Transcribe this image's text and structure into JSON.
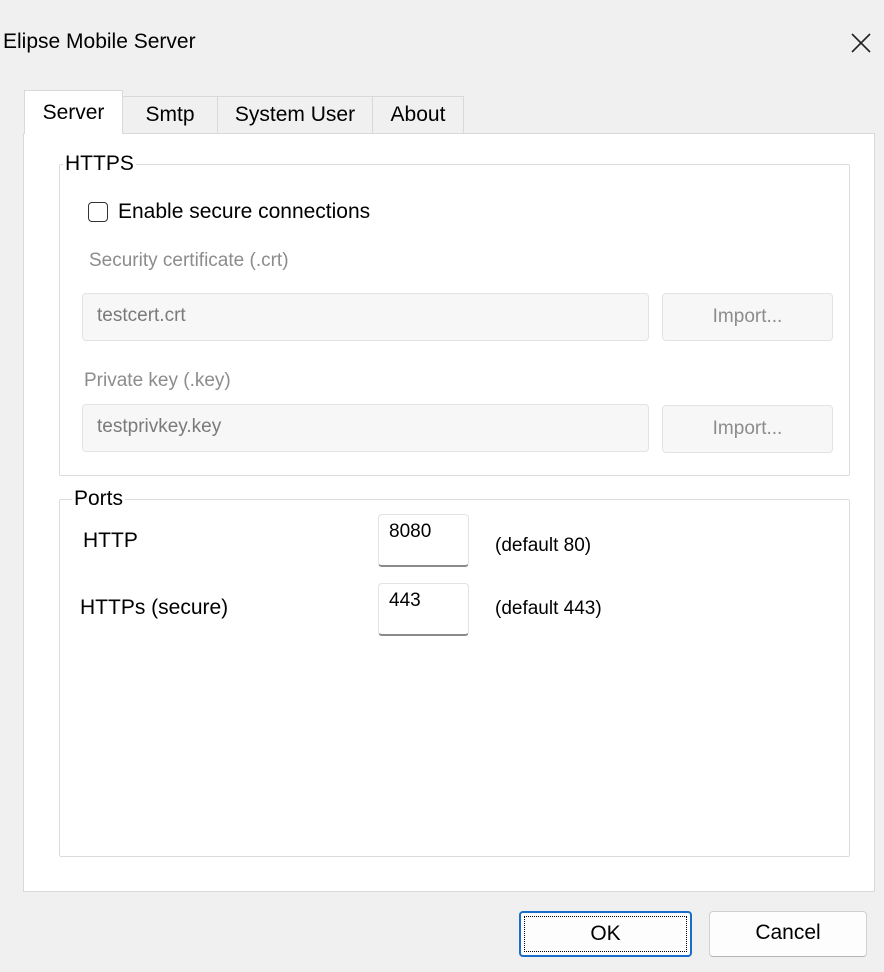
{
  "window": {
    "title": "Elipse Mobile Server",
    "close_icon": "close-icon"
  },
  "tabs": [
    {
      "label": "Server",
      "active": true
    },
    {
      "label": "Smtp",
      "active": false
    },
    {
      "label": "System User",
      "active": false
    },
    {
      "label": "About",
      "active": false
    }
  ],
  "https_group": {
    "legend": "HTTPS",
    "enable_secure_label": "Enable secure connections",
    "enable_secure_checked": false,
    "cert_label": "Security certificate (.crt)",
    "cert_value": "testcert.crt",
    "cert_import_label": "Import...",
    "key_label": "Private key (.key)",
    "key_value": "testprivkey.key",
    "key_import_label": "Import..."
  },
  "ports_group": {
    "legend": "Ports",
    "http_label": "HTTP",
    "http_value": "8080",
    "http_default": "(default 80)",
    "https_label": "HTTPs (secure)",
    "https_value": "443",
    "https_default": "(default 443)"
  },
  "footer": {
    "ok_label": "OK",
    "cancel_label": "Cancel"
  },
  "colors": {
    "window_bg": "#f0f0f0",
    "panel_bg": "#ffffff",
    "primary_border": "#1a6ec9",
    "disabled_text": "#8c8c8c"
  }
}
